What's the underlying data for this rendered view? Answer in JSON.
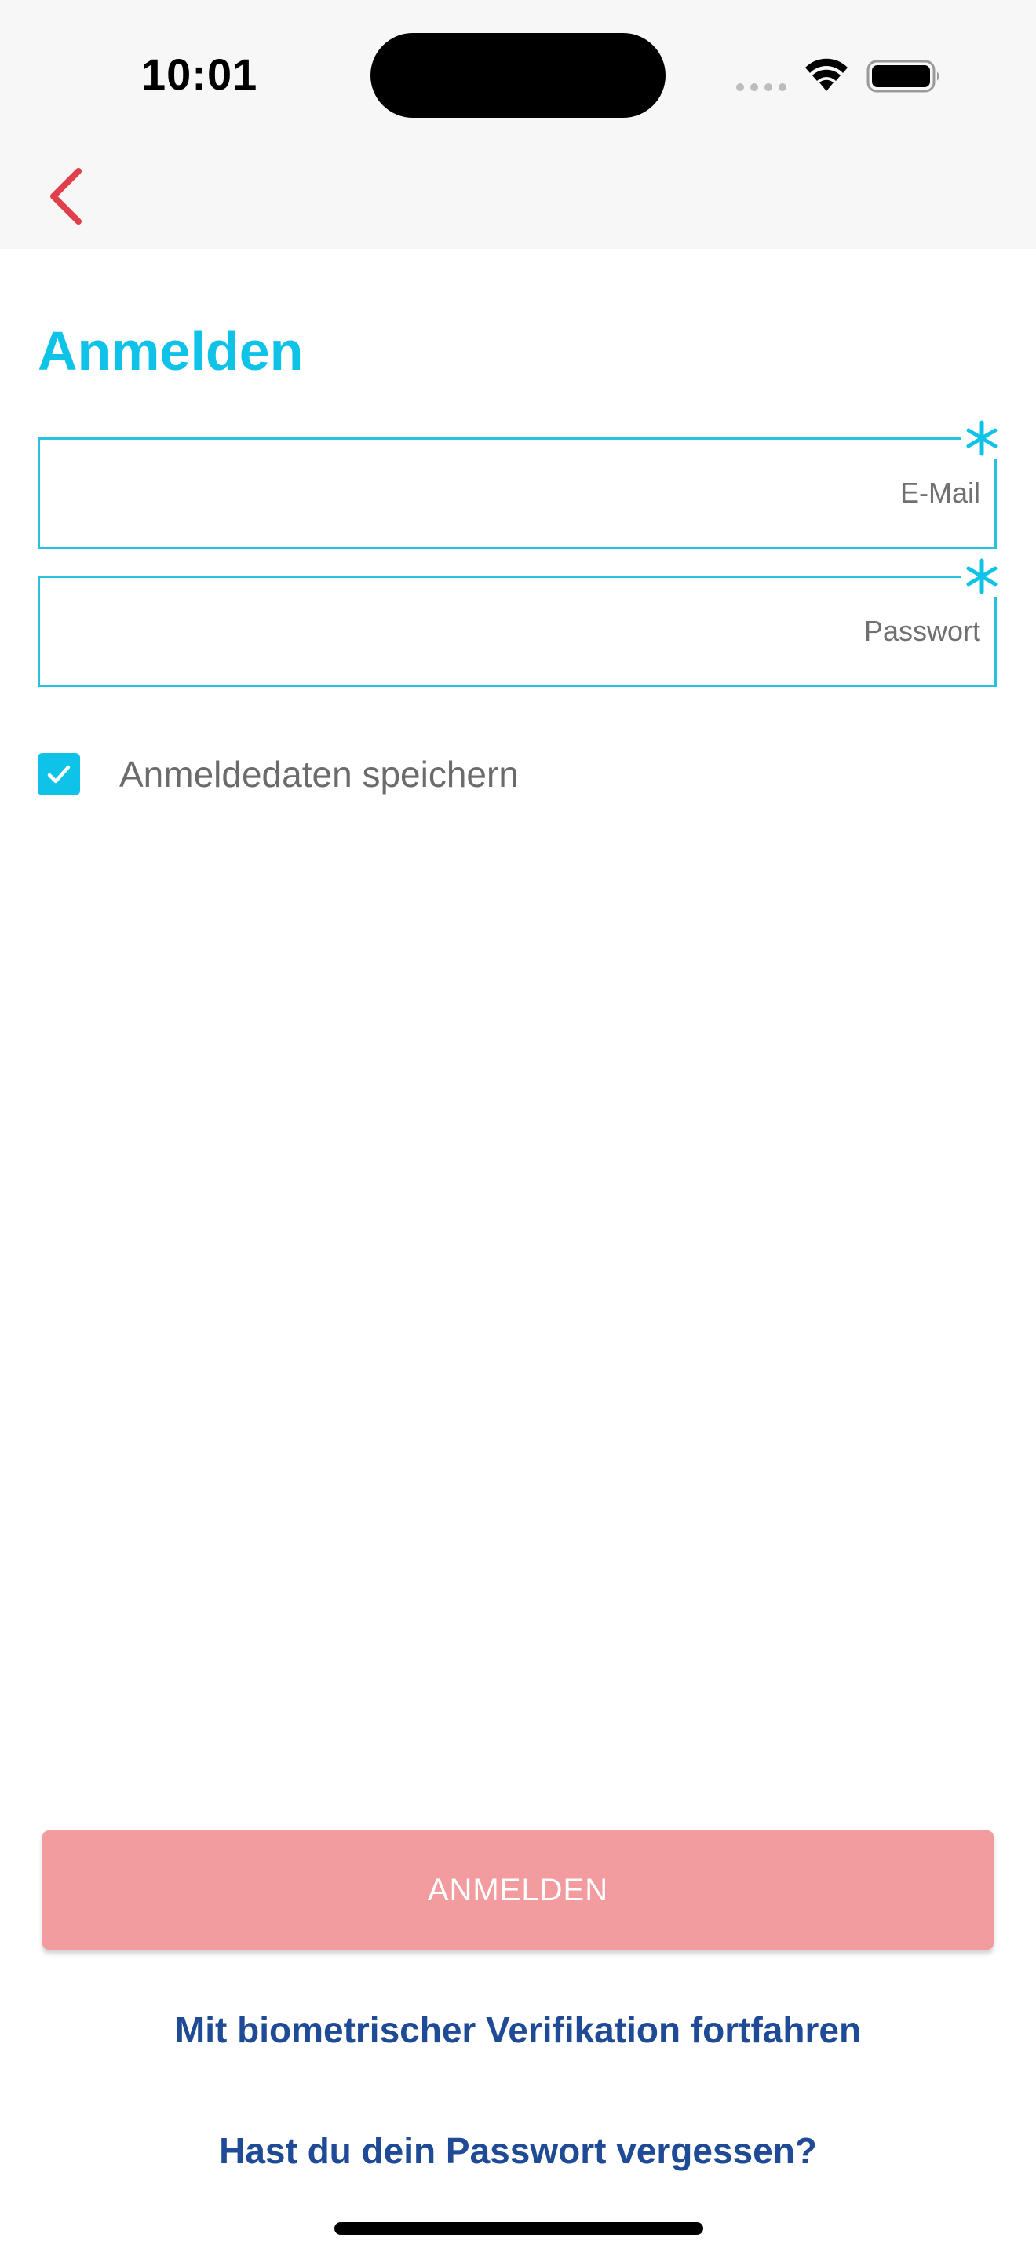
{
  "status_bar": {
    "time": "10:01",
    "icons": [
      "cellular-signal-icon",
      "wifi-icon",
      "battery-icon"
    ]
  },
  "nav": {
    "back_icon": "chevron-left-icon"
  },
  "page": {
    "title": "Anmelden"
  },
  "form": {
    "email": {
      "value": "",
      "placeholder": "E-Mail",
      "required": true
    },
    "password": {
      "value": "",
      "placeholder": "Passwort",
      "required": true
    },
    "remember": {
      "label": "Anmeldedaten speichern",
      "checked": true
    }
  },
  "actions": {
    "login_label": "ANMELDEN",
    "biometric_label": "Mit biometrischer Verifikation fortfahren",
    "forgot_label": "Hast du dein Passwort vergessen?"
  },
  "colors": {
    "accent": "#0fc3e8",
    "field_border": "#26c3e0",
    "back_icon": "#e0404b",
    "button_bg": "#f29ca0",
    "link": "#1f4a96"
  }
}
